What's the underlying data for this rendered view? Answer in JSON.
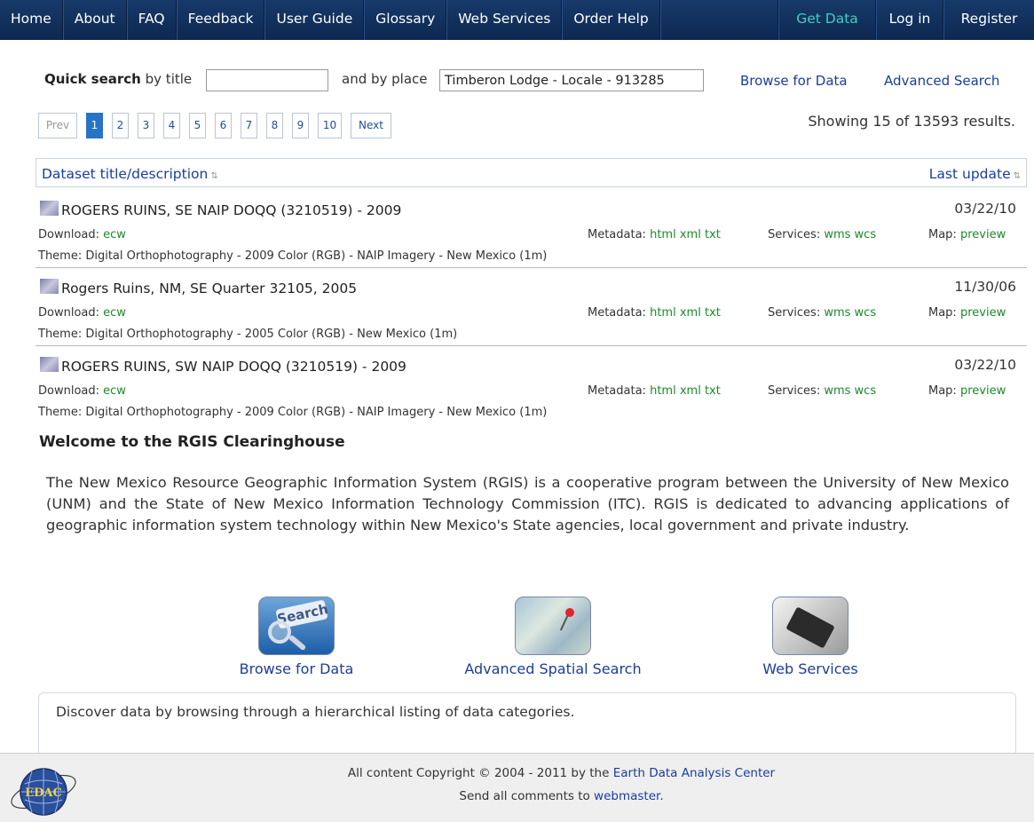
{
  "nav": {
    "items": [
      "Home",
      "About",
      "FAQ",
      "Feedback",
      "User Guide",
      "Glossary",
      "Web Services",
      "Order Help"
    ],
    "get_data": "Get Data",
    "login": "Log in",
    "register": "Register"
  },
  "quick_search": {
    "label_bold": "Quick search",
    "label_title": "by title",
    "title_value": "",
    "label_place": "and by place",
    "place_value": "Timberon Lodge - Locale - 913285",
    "browse_link": "Browse for Data",
    "advanced_link": "Advanced Search"
  },
  "pagination": {
    "prev": "Prev",
    "pages": [
      "1",
      "2",
      "3",
      "4",
      "5",
      "6",
      "7",
      "8",
      "9",
      "10"
    ],
    "active_page": "1",
    "next": "Next",
    "showing": "Showing 15 of 13593 results."
  },
  "table": {
    "col_title": "Dataset title/description",
    "col_date": "Last update",
    "sort_icon": "⇅",
    "rows": [
      {
        "title": "ROGERS RUINS, SE NAIP DOQQ (3210519) - 2009",
        "date": "03/22/10",
        "download_label": "Download:",
        "download_link": "ecw",
        "metadata_label": "Metadata:",
        "metadata_links": "html xml txt",
        "services_label": "Services:",
        "services_links": "wms wcs",
        "map_label": "Map:",
        "map_link": "preview",
        "theme": "Theme: Digital Orthophotography - 2009 Color (RGB) - NAIP Imagery - New Mexico (1m)"
      },
      {
        "title": "Rogers Ruins, NM, SE Quarter 32105, 2005",
        "date": "11/30/06",
        "download_label": "Download:",
        "download_link": "ecw",
        "metadata_label": "Metadata:",
        "metadata_links": "html xml txt",
        "services_label": "Services:",
        "services_links": "wms wcs",
        "map_label": "Map:",
        "map_link": "preview",
        "theme": "Theme: Digital Orthophotography - 2005 Color (RGB) - New Mexico (1m)"
      },
      {
        "title": "ROGERS RUINS, SW NAIP DOQQ (3210519) - 2009",
        "date": "03/22/10",
        "download_label": "Download:",
        "download_link": "ecw",
        "metadata_label": "Metadata:",
        "metadata_links": "html xml txt",
        "services_label": "Services:",
        "services_links": "wms wcs",
        "map_label": "Map:",
        "map_link": "preview",
        "theme": "Theme: Digital Orthophotography - 2009 Color (RGB) - NAIP Imagery - New Mexico (1m)"
      }
    ]
  },
  "welcome": {
    "heading": "Welcome to the RGIS Clearinghouse",
    "body": "The New Mexico Resource Geographic Information System (RGIS) is a cooperative program between the University of New Mexico (UNM) and the State of New Mexico Information Technology Commission (ITC). RGIS is dedicated to advancing applications of geographic information system technology within New Mexico's State agencies, local government and private industry."
  },
  "features": {
    "browse": {
      "label": "Browse for Data",
      "icon_text": "Search",
      "icon": "search-icon"
    },
    "spatial": {
      "label": "Advanced Spatial Search",
      "icon": "map-pin-icon"
    },
    "services": {
      "label": "Web Services",
      "icon": "device-icon"
    }
  },
  "info_box": "Discover data by browsing through a hierarchical listing of data categories.",
  "footer": {
    "copyright_prefix": "All content Copyright © 2004 - 2011 by the",
    "org_link": "Earth Data Analysis Center",
    "comments_prefix": "Send all comments to",
    "webmaster_link": "webmaster.",
    "logo_text": "EDAC"
  },
  "colors": {
    "nav_bg": "#173a6a",
    "link_blue": "#1a3d9c",
    "link_green": "#1c8a2a",
    "get_data": "#3fd0c0",
    "active_page": "#2774c6"
  }
}
